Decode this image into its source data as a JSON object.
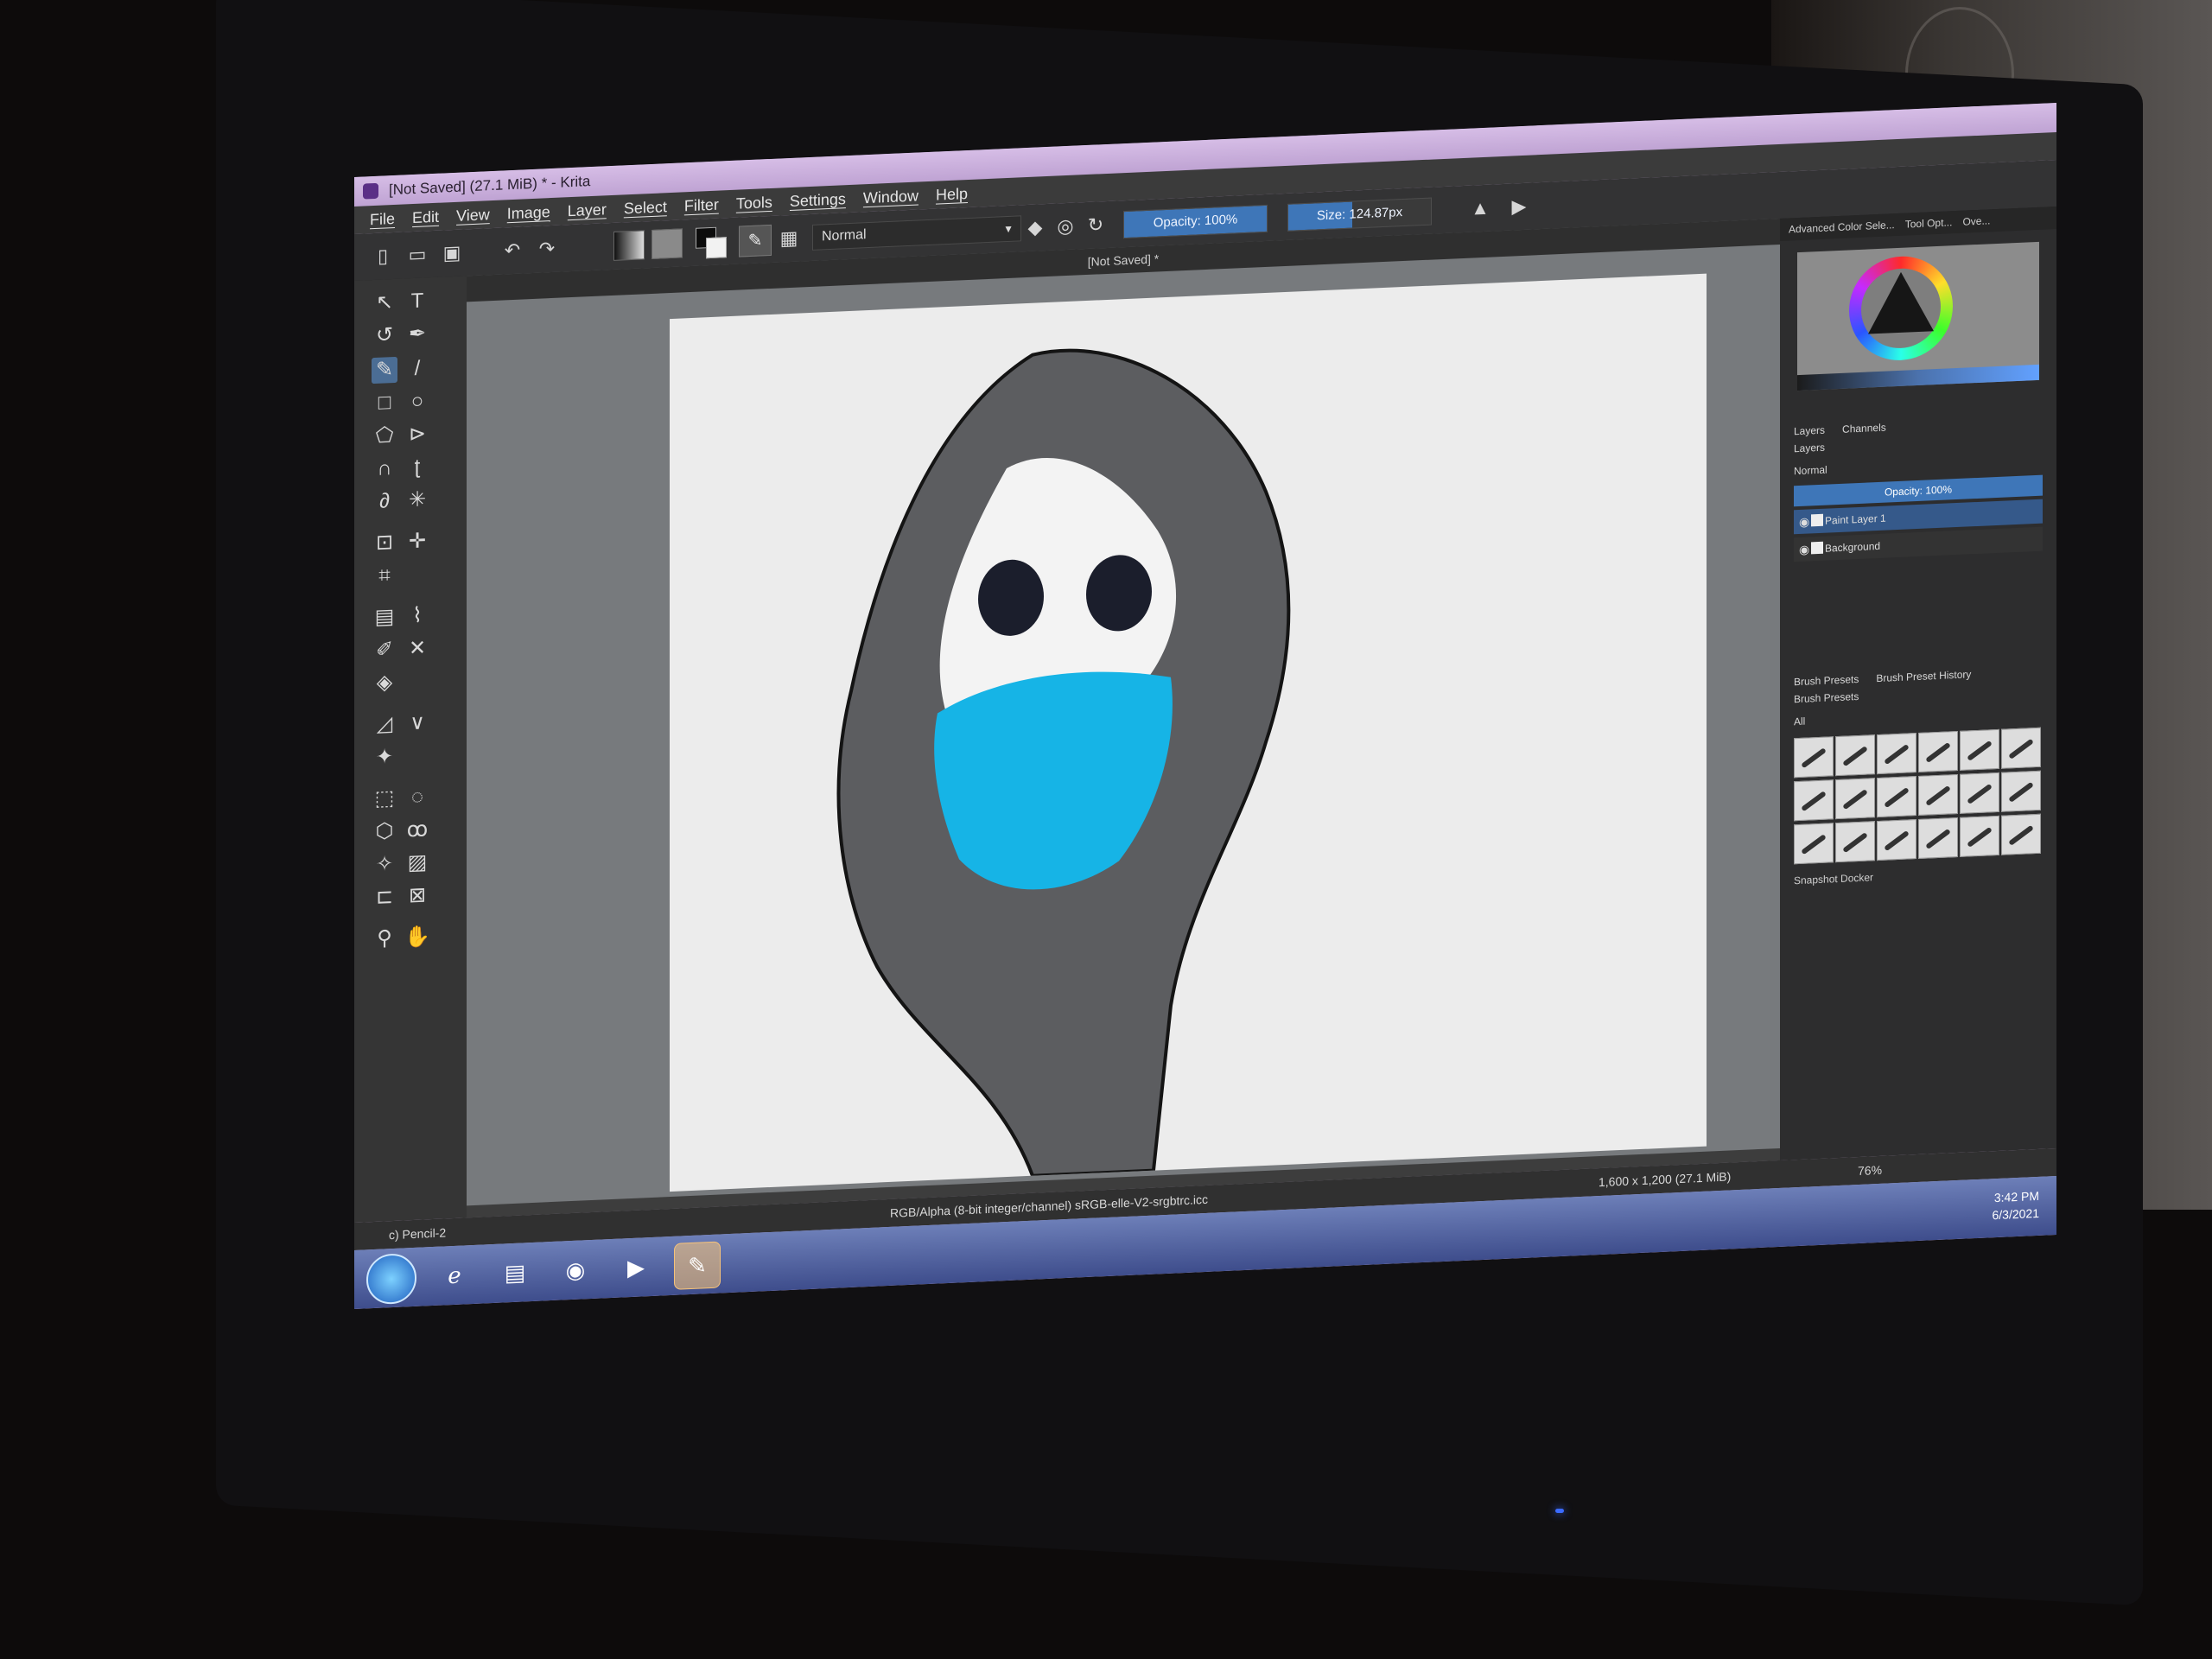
{
  "window": {
    "title": "[Not Saved]  (27.1 MiB)  * - Krita"
  },
  "menubar": {
    "items": [
      "File",
      "Edit",
      "View",
      "Image",
      "Layer",
      "Select",
      "Filter",
      "Tools",
      "Settings",
      "Window",
      "Help"
    ]
  },
  "toolbar": {
    "blend_mode": "Normal",
    "opacity_label": "Opacity: 100%",
    "opacity_value": 1.0,
    "size_label": "Size: 124.87px",
    "size_fill": 0.45,
    "icons": [
      "new-document-icon",
      "open-icon",
      "save-icon",
      "undo-icon",
      "redo-icon",
      "gradient-icon",
      "pattern-icon",
      "swap-colors-icon",
      "brush-preset-icon",
      "workspace-icon",
      "eraser-icon",
      "preserve-alpha-icon",
      "reload-icon",
      "mirror-horizontal-icon",
      "mirror-vertical-icon"
    ]
  },
  "canvas": {
    "tab_title": "[Not Saved]  *",
    "paper_color": "#ececec",
    "drawing": {
      "head_color": "#5c5d60",
      "face_color": "#f3f3f3",
      "eye_color": "#1b1e2c",
      "mask_color": "#16b4e6"
    }
  },
  "dockers": {
    "color_tabs": [
      "Advanced Color Sele...",
      "Tool Opt...",
      "Ove..."
    ],
    "layers_tabs": [
      "Layers",
      "Channels"
    ],
    "layers_header": "Layers",
    "blend_mode": "Normal",
    "layer_opacity": "Opacity: 100%",
    "layers": [
      {
        "name": "Paint Layer 1",
        "selected": true
      },
      {
        "name": "Background",
        "selected": false
      }
    ],
    "brush_tabs": [
      "Brush Presets",
      "Brush Preset History"
    ],
    "brush_header": "Brush Presets",
    "brush_filter": "All",
    "snapshot": "Snapshot Docker"
  },
  "statusbar": {
    "brush_name": "c) Pencil-2",
    "color_profile": "RGB/Alpha (8-bit integer/channel)  sRGB-elle-V2-srgbtrc.icc",
    "dimensions": "1,600 x 1,200 (27.1 MiB)",
    "zoom": "76%"
  },
  "taskbar": {
    "apps": [
      "internet-explorer-icon",
      "file-explorer-icon",
      "chrome-icon",
      "media-player-icon",
      "krita-icon"
    ],
    "time": "3:42 PM",
    "date": "6/3/2021"
  },
  "colors": {
    "accent": "#3e76b8",
    "titlebar": "#cbb0dc"
  }
}
